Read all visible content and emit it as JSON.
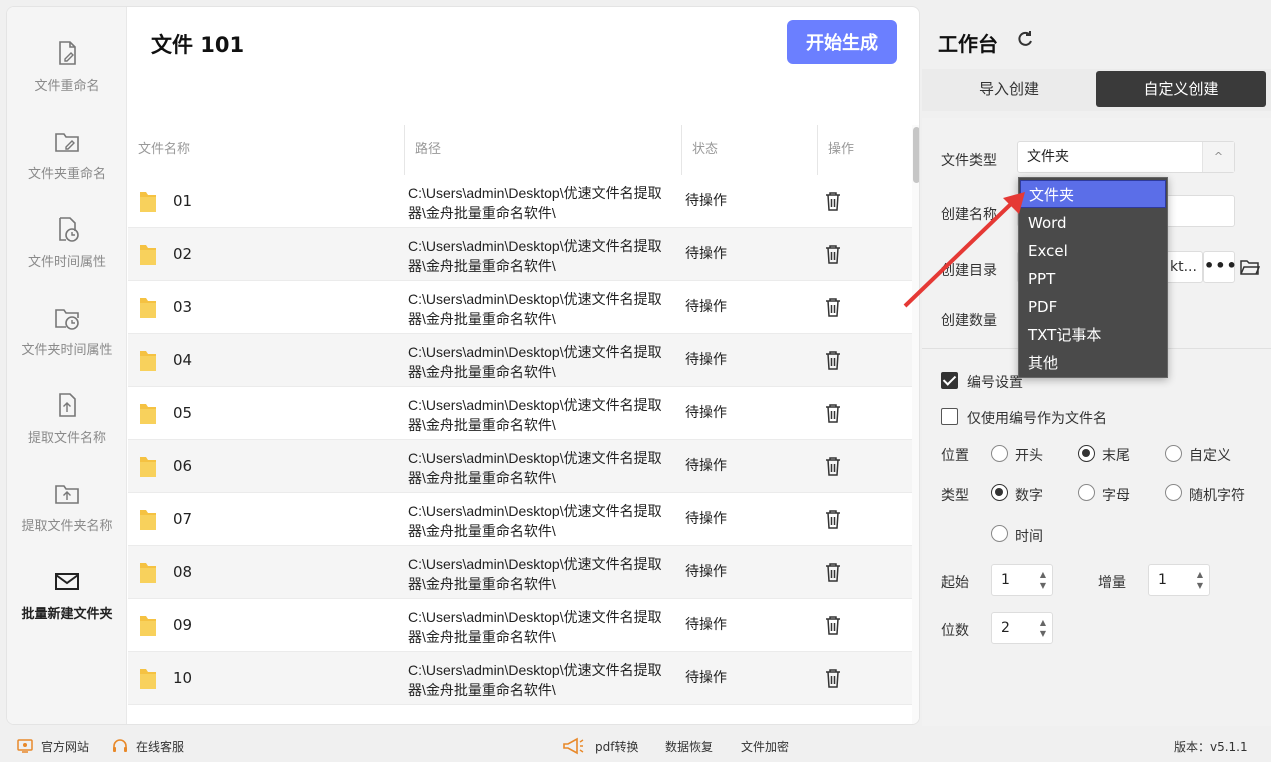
{
  "sidebar": {
    "items": [
      {
        "label": "文件重命名",
        "icon": "file-edit-icon"
      },
      {
        "label": "文件夹重命名",
        "icon": "folder-edit-icon"
      },
      {
        "label": "文件时间属性",
        "icon": "file-clock-icon"
      },
      {
        "label": "文件夹时间属性",
        "icon": "folder-clock-icon"
      },
      {
        "label": "提取文件名称",
        "icon": "file-upload-icon"
      },
      {
        "label": "提取文件夹名称",
        "icon": "folder-upload-icon"
      },
      {
        "label": "批量新建文件夹",
        "icon": "mail-folder-icon",
        "active": true
      }
    ]
  },
  "main": {
    "title": "文件 101",
    "generate_label": "开始生成",
    "columns": [
      "文件名称",
      "路径",
      "状态",
      "操作"
    ],
    "rows": [
      {
        "name": "01",
        "path": "C:\\Users\\admin\\Desktop\\优速文件名提取器\\金舟批量重命名软件\\",
        "status": "待操作"
      },
      {
        "name": "02",
        "path": "C:\\Users\\admin\\Desktop\\优速文件名提取器\\金舟批量重命名软件\\",
        "status": "待操作"
      },
      {
        "name": "03",
        "path": "C:\\Users\\admin\\Desktop\\优速文件名提取器\\金舟批量重命名软件\\",
        "status": "待操作"
      },
      {
        "name": "04",
        "path": "C:\\Users\\admin\\Desktop\\优速文件名提取器\\金舟批量重命名软件\\",
        "status": "待操作"
      },
      {
        "name": "05",
        "path": "C:\\Users\\admin\\Desktop\\优速文件名提取器\\金舟批量重命名软件\\",
        "status": "待操作"
      },
      {
        "name": "06",
        "path": "C:\\Users\\admin\\Desktop\\优速文件名提取器\\金舟批量重命名软件\\",
        "status": "待操作"
      },
      {
        "name": "07",
        "path": "C:\\Users\\admin\\Desktop\\优速文件名提取器\\金舟批量重命名软件\\",
        "status": "待操作"
      },
      {
        "name": "08",
        "path": "C:\\Users\\admin\\Desktop\\优速文件名提取器\\金舟批量重命名软件\\",
        "status": "待操作"
      },
      {
        "name": "09",
        "path": "C:\\Users\\admin\\Desktop\\优速文件名提取器\\金舟批量重命名软件\\",
        "status": "待操作"
      },
      {
        "name": "10",
        "path": "C:\\Users\\admin\\Desktop\\优速文件名提取器\\金舟批量重命名软件\\",
        "status": "待操作"
      }
    ]
  },
  "workbench": {
    "title": "工作台",
    "tabs": [
      "导入创建",
      "自定义创建"
    ],
    "active_tab": "自定义创建",
    "file_type_label": "文件类型",
    "file_type_value": "文件夹",
    "create_name_label": "创建名称",
    "create_dir_label": "创建目录",
    "create_dir_value": "kt...",
    "create_count_label": "创建数量",
    "numbering_label": "编号设置",
    "numbering_checked": true,
    "only_number_label": "仅使用编号作为文件名",
    "only_number_checked": false,
    "position_label": "位置",
    "position_options": [
      "开头",
      "末尾",
      "自定义"
    ],
    "position_selected": "末尾",
    "type_label": "类型",
    "type_options": [
      "数字",
      "字母",
      "随机字符",
      "时间"
    ],
    "type_selected": "数字",
    "start_label": "起始",
    "start_value": "1",
    "increment_label": "增量",
    "increment_value": "1",
    "digits_label": "位数",
    "digits_value": "2"
  },
  "dropdown": {
    "options": [
      "文件夹",
      "Word",
      "Excel",
      "PPT",
      "PDF",
      "TXT记事本",
      "其他"
    ],
    "selected": "文件夹"
  },
  "footer": {
    "website": "官方网站",
    "support": "在线客服",
    "pdf": "pdf转换",
    "recovery": "数据恢复",
    "encrypt": "文件加密",
    "version": "版本：v5.1.1"
  },
  "colors": {
    "accent": "#6b7fff",
    "dark_tab": "#3a3a3a",
    "dropdown_bg": "#4a4a4a",
    "dropdown_sel": "#5b6ee8",
    "arrow": "#e53935",
    "folder": "#f5c242"
  }
}
